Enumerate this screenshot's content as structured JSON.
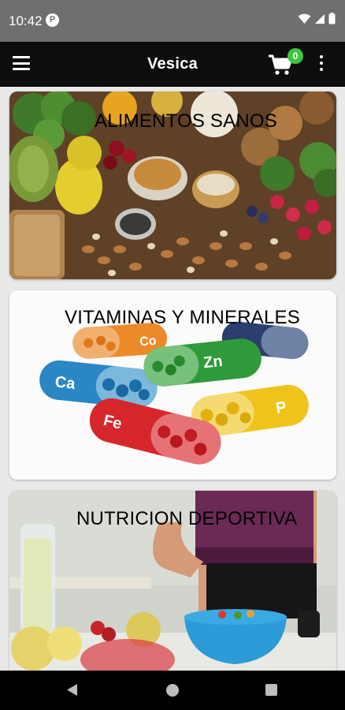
{
  "status_bar": {
    "time": "10:42",
    "notification_letter": "P"
  },
  "app_bar": {
    "title": "Vesica",
    "cart_count": "0"
  },
  "categories": [
    {
      "label": "ALIMENTOS SANOS",
      "image": "healthy-foods-image"
    },
    {
      "label": "VITAMINAS Y MINERALES",
      "image": "vitamin-capsules-image"
    },
    {
      "label": "NUTRICION DEPORTIVA",
      "image": "sports-nutrition-image"
    }
  ],
  "capsule_labels": {
    "ca": "Ca",
    "zn": "Zn",
    "fe": "Fe",
    "p": "P",
    "co": "Co"
  },
  "colors": {
    "status_bar": "#6f6f6f",
    "app_bar": "#0d0d0d",
    "badge": "#3fc63f",
    "background": "#e9e9e9"
  }
}
